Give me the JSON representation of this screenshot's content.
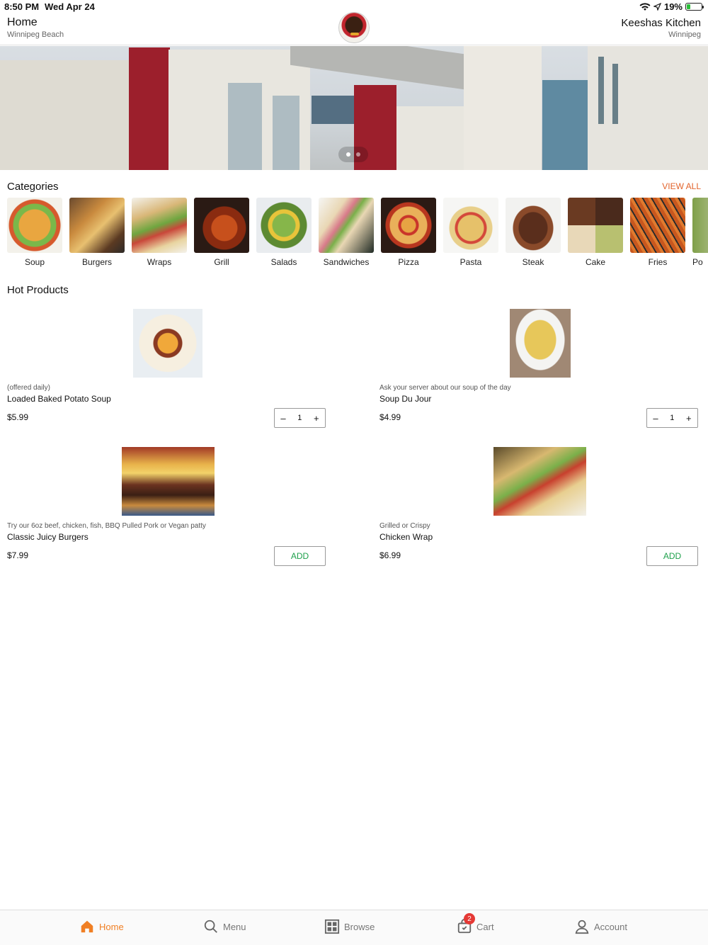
{
  "status_bar": {
    "time": "8:50 PM",
    "date": "Wed Apr 24",
    "battery": "19%"
  },
  "header": {
    "title": "Home",
    "subtitle": "Winnipeg Beach",
    "store_name": "Keeshas Kitchen",
    "store_city": "Winnipeg",
    "logo_text": "Keesha's Kitchen"
  },
  "banner": {
    "slide_count": 2,
    "active_slide": 1
  },
  "categories": {
    "title": "Categories",
    "view_all": "VIEW ALL",
    "items": [
      "Soup",
      "Burgers",
      "Wraps",
      "Grill",
      "Salads",
      "Sandwiches",
      "Pizza",
      "Pasta",
      "Steak",
      "Cake",
      "Fries",
      "Po"
    ]
  },
  "hot_products": {
    "title": "Hot Products",
    "items": [
      {
        "desc": "(offered daily)",
        "name": "Loaded Baked Potato Soup",
        "price": "$5.99",
        "qty": "1",
        "minus": "–",
        "plus": "+"
      },
      {
        "desc": "Ask your server about our soup of the day",
        "name": "Soup Du Jour",
        "price": "$4.99",
        "qty": "1",
        "minus": "–",
        "plus": "+"
      },
      {
        "desc": "Try our 6oz beef, chicken, fish, BBQ Pulled Pork or Vegan patty",
        "name": "Classic Juicy Burgers",
        "price": "$7.99",
        "add": "ADD"
      },
      {
        "desc": "Grilled or Crispy",
        "name": "Chicken Wrap",
        "price": "$6.99",
        "add": "ADD"
      }
    ]
  },
  "tabbar": {
    "home": "Home",
    "menu": "Menu",
    "browse": "Browse",
    "cart": "Cart",
    "cart_badge": "2",
    "account": "Account"
  },
  "colors": {
    "accent": "#f07f24",
    "view_all": "#e2632b",
    "add_green": "#1ea04b",
    "badge_red": "#e53935"
  }
}
